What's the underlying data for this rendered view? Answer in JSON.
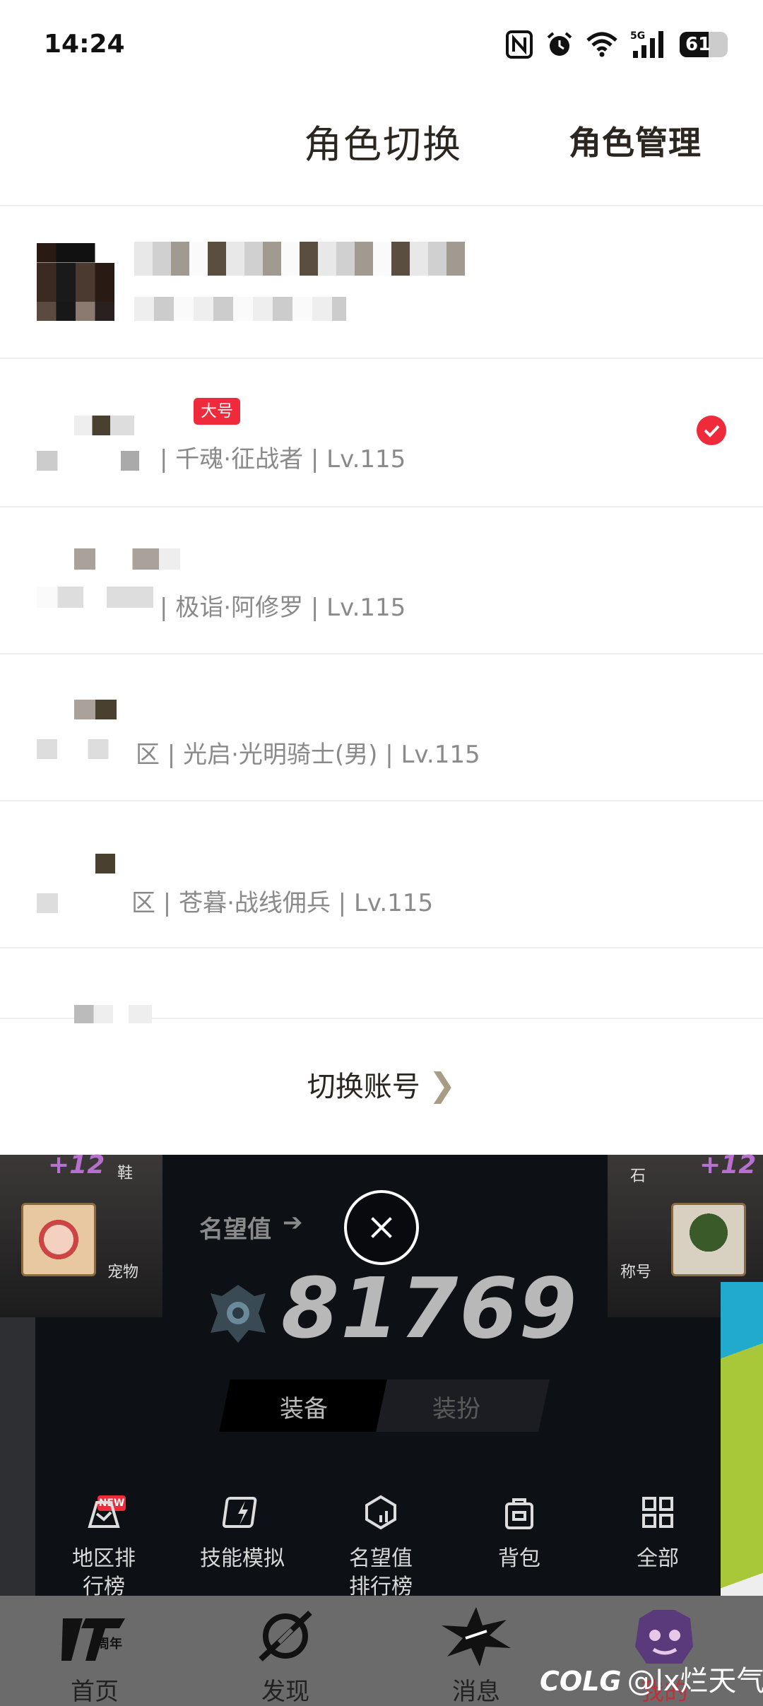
{
  "status_bar": {
    "time": "14:24",
    "battery": "61",
    "network": "5G",
    "battery_level": 0.61
  },
  "header": {
    "title": "角色切换",
    "manage_label": "角色管理"
  },
  "roles": [
    {
      "role_text": "| 千魂·征战者 | Lv.115",
      "badge": "大号",
      "selected": true
    },
    {
      "role_text": "| 极诣·阿修罗 | Lv.115",
      "selected": false
    },
    {
      "role_text": "区 | 光启·光明骑士(男) | Lv.115",
      "selected": false
    },
    {
      "role_text": "区 | 苍暮·战线佣兵 | Lv.115",
      "selected": false
    }
  ],
  "switch_account": {
    "label": "切换账号",
    "chevron": "❯"
  },
  "game": {
    "fame_label": "名望值",
    "fame_value": "81769",
    "tabs": [
      "装备",
      "装扮"
    ],
    "slots": {
      "shoes": "鞋",
      "pet": "宠物",
      "stone": "石",
      "title": "称号",
      "plus": "+12"
    },
    "functions": [
      {
        "label": "地区排\n行榜",
        "icon": "rank-map-icon"
      },
      {
        "label": "技能模拟",
        "icon": "skill-sim-icon"
      },
      {
        "label": "名望值\n排行榜",
        "icon": "fame-rank-icon"
      },
      {
        "label": "背包",
        "icon": "bag-icon"
      },
      {
        "label": "全部",
        "icon": "grid-icon"
      }
    ],
    "new_tag": "NEW"
  },
  "bottom_nav": [
    {
      "label": "首页",
      "icon": "home-logo-icon"
    },
    {
      "label": "发现",
      "icon": "discover-icon"
    },
    {
      "label": "消息",
      "icon": "message-icon"
    },
    {
      "label": "我的",
      "icon": "profile-icon"
    }
  ],
  "watermark": {
    "brand": "COLG",
    "handle": "@lx烂天气"
  }
}
